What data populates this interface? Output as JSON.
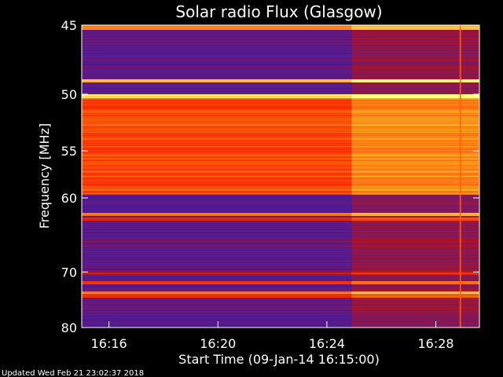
{
  "chart_data": {
    "type": "heatmap",
    "title": "Solar radio Flux (Glasgow)",
    "xlabel": "Start Time (09-Jan-14 16:15:00)",
    "ylabel": "Frequency [MHz]",
    "x_ticks": [
      "16:16",
      "16:20",
      "16:24",
      "16:28"
    ],
    "x_tick_minutes": [
      1,
      5,
      9,
      13
    ],
    "x_range_minutes": [
      0,
      14.6
    ],
    "y_ticks": [
      "45",
      "50",
      "55",
      "60",
      "70",
      "80"
    ],
    "y_tick_values": [
      45,
      50,
      55,
      60,
      70,
      80
    ],
    "ylim": [
      45,
      80
    ],
    "y_scale": "reciprocal",
    "colormap": [
      "#1a0f9c",
      "#5a1a8c",
      "#b0141e",
      "#ff2a00",
      "#ff9a1a",
      "#ffff80"
    ],
    "bright_bands_mhz": [
      {
        "from": 45.0,
        "to": 45.3,
        "level": 0.75
      },
      {
        "from": 48.8,
        "to": 49.1,
        "level": 0.85
      },
      {
        "from": 50.0,
        "to": 50.3,
        "level": 0.95
      },
      {
        "from": 50.3,
        "to": 59.6,
        "level": 0.65
      },
      {
        "from": 61.8,
        "to": 62.2,
        "level": 0.72
      },
      {
        "from": 62.4,
        "to": 62.8,
        "level": 0.55
      },
      {
        "from": 70.0,
        "to": 70.4,
        "level": 0.45
      },
      {
        "from": 71.5,
        "to": 72.0,
        "level": 0.6
      },
      {
        "from": 73.2,
        "to": 73.7,
        "level": 0.72
      },
      {
        "from": 73.9,
        "to": 74.3,
        "level": 0.6
      }
    ],
    "background_level": 0.15,
    "enhanced_after_minute": 9.9,
    "enhanced_level_boost": 0.12,
    "vertical_burst_minute": 13.9,
    "grid": false
  },
  "footer": {
    "updated": "Updated Wed Feb 21 23:02:37 2018"
  }
}
